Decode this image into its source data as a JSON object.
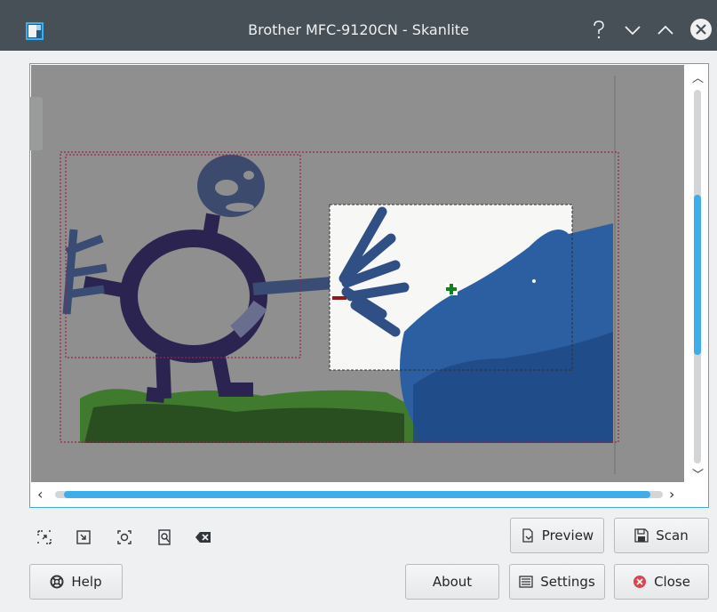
{
  "window": {
    "title": "Brother MFC-9120CN - Skanlite",
    "icons": [
      "app-icon",
      "help-icon",
      "minimize-icon",
      "maximize-icon",
      "close-icon"
    ]
  },
  "preview": {
    "selection_markers": {
      "remove": "−",
      "add": "+"
    }
  },
  "toolbar": {
    "icons": [
      "zoom-fit-selection-icon",
      "zoom-to-selection-icon",
      "auto-select-icon",
      "zoom-fit-page-icon",
      "clear-selections-icon"
    ]
  },
  "buttons": {
    "preview": "Preview",
    "scan": "Scan",
    "help": "Help",
    "about": "About",
    "settings": "Settings",
    "close": "Close"
  },
  "colors": {
    "titlebar": "#475057",
    "accent": "#3daee9",
    "selection_border": "#a0204a",
    "close_red": "#da4453",
    "add_green": "#11821d",
    "remove_red": "#8b1c1c"
  }
}
